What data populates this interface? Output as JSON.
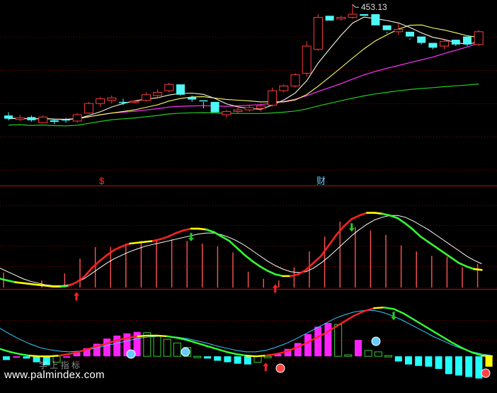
{
  "price_label": "453.13",
  "marker_dollar": "$",
  "marker_cai": "财",
  "watermark": "www.palmindex.com",
  "faint_text": "学 上 指 标",
  "colors": {
    "bg": "#000000",
    "grid": "#8b0000",
    "candle_up": "#ff3b3b",
    "candle_down": "#4ff7f7",
    "ma_white": "#f5f5dc",
    "ma_yellow": "#ffff66",
    "ma_magenta": "#ff33ff",
    "ma_green": "#22cc22",
    "osc_red": "#ff2222",
    "osc_yellow": "#ffff00",
    "osc_green": "#33ff33",
    "osc_signal": "#ffffff",
    "hist_red": "#ff5555",
    "hist_magenta": "#ff22ff",
    "hist_cyan": "#22ffff",
    "hist_green": "#33cc33",
    "hist_yellow": "#ffff00",
    "arrow_up": "#ff2222",
    "arrow_down": "#22cc22"
  },
  "chart_data": [
    {
      "type": "candlestick",
      "panel": "price",
      "annotation": "453.13",
      "candles": [
        [
          383.5,
          385.5,
          380.5,
          381.5
        ],
        [
          381,
          384,
          380,
          382
        ],
        [
          382.5,
          383.5,
          379.5,
          380.5
        ],
        [
          379,
          383.5,
          378.5,
          382.5
        ],
        [
          380.5,
          381.5,
          378,
          379.5
        ],
        [
          381,
          382,
          379,
          380.5
        ],
        [
          380,
          385,
          379,
          384
        ],
        [
          385,
          392,
          384.5,
          391
        ],
        [
          391,
          395,
          389,
          394
        ],
        [
          393,
          396,
          391,
          394.5
        ],
        [
          392,
          394,
          390,
          391.5
        ],
        [
          392,
          393,
          391,
          392.5
        ],
        [
          393,
          398,
          392,
          396.5
        ],
        [
          396,
          400,
          395,
          398
        ],
        [
          399,
          404,
          398,
          403
        ],
        [
          403,
          397,
          396,
          396.5
        ],
        [
          395,
          396,
          392,
          393.5
        ],
        [
          393,
          392,
          388,
          392.5
        ],
        [
          392,
          387,
          387,
          385.5
        ],
        [
          384,
          387,
          382,
          386
        ],
        [
          386,
          389,
          385,
          387
        ],
        [
          387,
          390,
          386,
          388.5
        ],
        [
          388,
          391,
          386,
          389.5
        ],
        [
          390,
          401,
          389,
          399
        ],
        [
          399,
          403,
          398,
          402
        ],
        [
          402,
          410,
          401,
          409
        ],
        [
          410,
          430,
          408,
          427
        ],
        [
          425,
          447,
          424,
          445
        ],
        [
          446,
          444,
          444,
          443
        ],
        [
          444,
          446,
          443,
          445
        ],
        [
          445,
          453.13,
          444,
          447
        ],
        [
          447,
          447,
          446,
          446
        ],
        [
          447,
          441,
          440,
          440
        ],
        [
          440,
          436,
          435,
          437
        ],
        [
          436,
          441,
          434,
          437.5
        ],
        [
          436,
          432,
          431,
          433
        ],
        [
          433,
          429,
          428,
          429
        ],
        [
          429,
          426,
          425,
          426
        ],
        [
          427,
          431,
          425,
          430
        ],
        [
          431,
          429,
          427,
          428
        ],
        [
          433,
          428,
          427,
          428
        ],
        [
          428,
          437,
          427,
          436
        ]
      ],
      "ylim": [
        368,
        455
      ]
    },
    {
      "type": "line",
      "panel": "oscillator",
      "series": [
        {
          "key": "main",
          "values": [
            10,
            8,
            6,
            5,
            4,
            3,
            2,
            1,
            1,
            2,
            6,
            12,
            22,
            30,
            37,
            43,
            47,
            50,
            51,
            52,
            53,
            55,
            58,
            62,
            65,
            67,
            67,
            66,
            63,
            58,
            53,
            45,
            37,
            30,
            24,
            19,
            15,
            13,
            13,
            15,
            20,
            28,
            36,
            48,
            60,
            70,
            78,
            82,
            85,
            85,
            84,
            82,
            79,
            73,
            66,
            58,
            52,
            46,
            40,
            34,
            28,
            24,
            21,
            20
          ]
        },
        {
          "key": "signal",
          "values": [
            22,
            18,
            14,
            10,
            7,
            5,
            3,
            2,
            2,
            3,
            6,
            10,
            16,
            22,
            28,
            33,
            37,
            41,
            44,
            47,
            49,
            51,
            53,
            55,
            57,
            59,
            61,
            62,
            62,
            60,
            57,
            53,
            48,
            42,
            36,
            30,
            25,
            21,
            18,
            17,
            18,
            22,
            28,
            35,
            43,
            51,
            59,
            66,
            72,
            77,
            80,
            82,
            82,
            80,
            76,
            71,
            66,
            60,
            54,
            48,
            42,
            36,
            31,
            27
          ]
        }
      ],
      "bars": [
        {
          "i": 0,
          "h": 0.17
        },
        {
          "i": 5,
          "h": 0.08
        },
        {
          "i": 8,
          "h": 0.16
        },
        {
          "i": 10,
          "h": 0.33
        },
        {
          "i": 12,
          "h": 0.46
        },
        {
          "i": 14,
          "h": 0.46
        },
        {
          "i": 16,
          "h": 0.5
        },
        {
          "i": 18,
          "h": 0.53
        },
        {
          "i": 20,
          "h": 0.54
        },
        {
          "i": 22,
          "h": 0.55
        },
        {
          "i": 24,
          "h": 0.53
        },
        {
          "i": 26,
          "h": 0.5
        },
        {
          "i": 28,
          "h": 0.47
        },
        {
          "i": 30,
          "h": 0.4
        },
        {
          "i": 32,
          "h": 0.18
        },
        {
          "i": 34,
          "h": 0.1
        },
        {
          "i": 36,
          "h": 0.08
        },
        {
          "i": 38,
          "h": 0.23
        },
        {
          "i": 40,
          "h": 0.41
        },
        {
          "i": 42,
          "h": 0.58
        },
        {
          "i": 44,
          "h": 0.75
        },
        {
          "i": 46,
          "h": 0.69
        },
        {
          "i": 48,
          "h": 0.65
        },
        {
          "i": 50,
          "h": 0.6
        },
        {
          "i": 52,
          "h": 0.48
        },
        {
          "i": 54,
          "h": 0.41
        },
        {
          "i": 56,
          "h": 0.36
        },
        {
          "i": 58,
          "h": 0.35
        },
        {
          "i": 60,
          "h": 0.23
        },
        {
          "i": 62,
          "h": 0.27
        }
      ],
      "signals": [
        {
          "type": "buy",
          "i": 10
        },
        {
          "type": "sell",
          "i": 25
        },
        {
          "type": "buy",
          "i": 36
        },
        {
          "type": "sell",
          "i": 46
        }
      ],
      "ylim": [
        0,
        100
      ]
    },
    {
      "type": "line",
      "panel": "macd",
      "series": [
        {
          "key": "main",
          "values": [
            10,
            6,
            3,
            1,
            0,
            0,
            1,
            3,
            6,
            10,
            14,
            18,
            22,
            25,
            27,
            28,
            28,
            27,
            25,
            22,
            18,
            14,
            10,
            6,
            3,
            1,
            0,
            1,
            3,
            6,
            11,
            17,
            24,
            31,
            39,
            47,
            55,
            61,
            65,
            66,
            64,
            58,
            50,
            42,
            34,
            26,
            18,
            11,
            5,
            1,
            0
          ]
        },
        {
          "key": "signal",
          "values": [
            38,
            30,
            23,
            17,
            12,
            9,
            7,
            6,
            7,
            9,
            12,
            15,
            18,
            21,
            24,
            26,
            27,
            27,
            26,
            24,
            21,
            18,
            14,
            11,
            8,
            6,
            6,
            8,
            12,
            17,
            23,
            30,
            37,
            44,
            51,
            56,
            60,
            62,
            62,
            59,
            54,
            48,
            41,
            34,
            27,
            21,
            15,
            10,
            6,
            3,
            1
          ]
        }
      ],
      "hist": [
        -5,
        0,
        -3,
        -8,
        -12,
        -8,
        0,
        5,
        11,
        17,
        24,
        28,
        31,
        33,
        32,
        28,
        23,
        18,
        12,
        0,
        -3,
        -6,
        -8,
        -10,
        -11,
        -8,
        -2,
        3,
        10,
        18,
        30,
        40,
        45,
        43,
        2,
        22,
        8,
        6,
        1,
        -7,
        -11,
        -13,
        -14,
        -17,
        -24,
        -26,
        -28,
        -30,
        -14
      ],
      "signals": [
        {
          "type": "buy",
          "i": 27
        },
        {
          "type": "sell",
          "i": 40
        }
      ],
      "ylim": [
        -40,
        70
      ]
    }
  ]
}
